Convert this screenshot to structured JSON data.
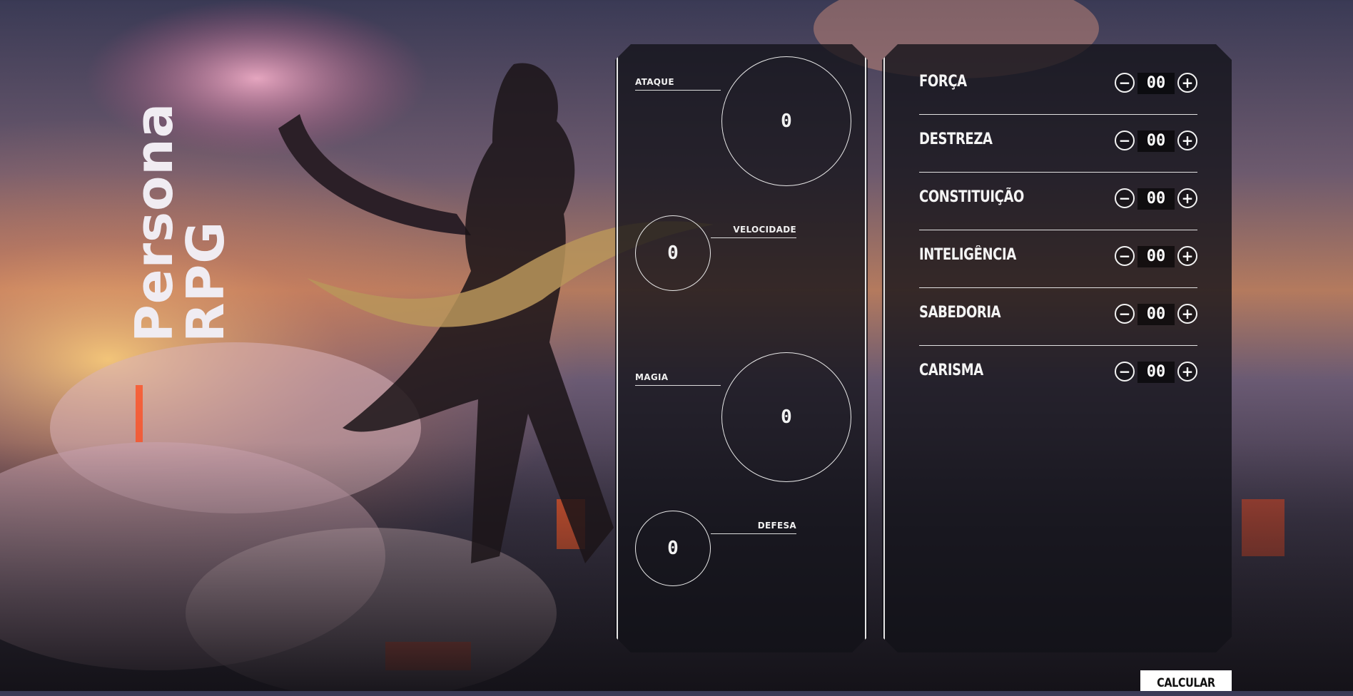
{
  "title": {
    "line1": "Persona",
    "line2": "RPG"
  },
  "stats": [
    {
      "label": "ATAQUE",
      "value": "0"
    },
    {
      "label": "VELOCIDADE",
      "value": "0"
    },
    {
      "label": "MAGIA",
      "value": "0"
    },
    {
      "label": "DEFESA",
      "value": "0"
    }
  ],
  "attributes": [
    {
      "name": "FORÇA",
      "value": "00",
      "minus": "−",
      "plus": "+"
    },
    {
      "name": "DESTREZA",
      "value": "00",
      "minus": "−",
      "plus": "+"
    },
    {
      "name": "CONSTITUIÇÃO",
      "value": "00",
      "minus": "−",
      "plus": "+"
    },
    {
      "name": "INTELIGÊNCIA",
      "value": "00",
      "minus": "−",
      "plus": "+"
    },
    {
      "name": "SABEDORIA",
      "value": "00",
      "minus": "−",
      "plus": "+"
    },
    {
      "name": "CARISMA",
      "value": "00",
      "minus": "−",
      "plus": "+"
    }
  ],
  "calculate_label": "CALCULAR",
  "colors": {
    "accent": "#ffffff",
    "panel": "#121218",
    "lava": "#ff4a1c"
  }
}
